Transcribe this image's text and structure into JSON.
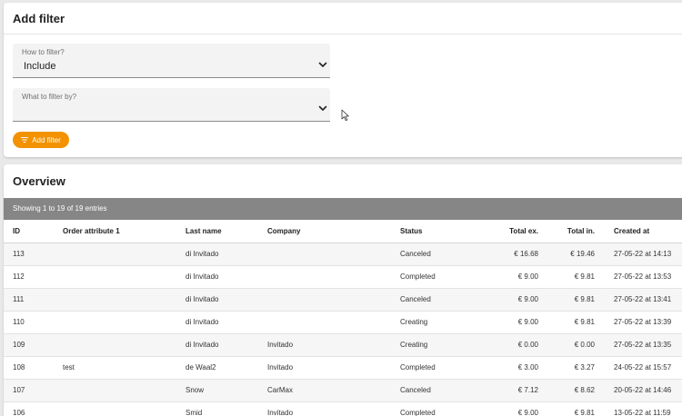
{
  "filter": {
    "title": "Add filter",
    "how": {
      "label": "How to filter?",
      "value": "Include"
    },
    "what": {
      "label": "What to filter by?",
      "value": ""
    },
    "add_button": "Add filter"
  },
  "overview": {
    "title": "Overview",
    "showing": "Showing 1 to 19 of 19 entries",
    "columns": [
      "ID",
      "Order attribute 1",
      "Last name",
      "Company",
      "Status",
      "Total ex.",
      "Total in.",
      "Created at"
    ],
    "rows": [
      {
        "id": "113",
        "attr": "",
        "last": "di Invitado",
        "company": "",
        "status": "Canceled",
        "ex": "€ 16.68",
        "inc": "€ 19.46",
        "created": "27-05-22 at 14:13"
      },
      {
        "id": "112",
        "attr": "",
        "last": "di Invitado",
        "company": "",
        "status": "Completed",
        "ex": "€ 9.00",
        "inc": "€ 9.81",
        "created": "27-05-22 at 13:53"
      },
      {
        "id": "111",
        "attr": "",
        "last": "di Invitado",
        "company": "",
        "status": "Canceled",
        "ex": "€ 9.00",
        "inc": "€ 9.81",
        "created": "27-05-22 at 13:41"
      },
      {
        "id": "110",
        "attr": "",
        "last": "di Invitado",
        "company": "",
        "status": "Creating",
        "ex": "€ 9.00",
        "inc": "€ 9.81",
        "created": "27-05-22 at 13:39"
      },
      {
        "id": "109",
        "attr": "",
        "last": "di Invitado",
        "company": "Invitado",
        "status": "Creating",
        "ex": "€ 0.00",
        "inc": "€ 0.00",
        "created": "27-05-22 at 13:35"
      },
      {
        "id": "108",
        "attr": "test",
        "last": "de Waal2",
        "company": "Invitado",
        "status": "Completed",
        "ex": "€ 3.00",
        "inc": "€ 3.27",
        "created": "24-05-22 at 15:57"
      },
      {
        "id": "107",
        "attr": "",
        "last": "Snow",
        "company": "CarMax",
        "status": "Canceled",
        "ex": "€ 7.12",
        "inc": "€ 8.62",
        "created": "20-05-22 at 14:46"
      },
      {
        "id": "106",
        "attr": "",
        "last": "Smid",
        "company": "Invitado",
        "status": "Completed",
        "ex": "€ 9.00",
        "inc": "€ 9.81",
        "created": "13-05-22 at 11:59"
      }
    ]
  },
  "colors": {
    "accent": "#f39200",
    "header_bar": "#868686",
    "background": "#e9e9e9"
  },
  "icons": {
    "add_filter": "filter-lines-icon",
    "select": "chevron-down-icon",
    "cursor": "mouse-pointer-icon"
  }
}
